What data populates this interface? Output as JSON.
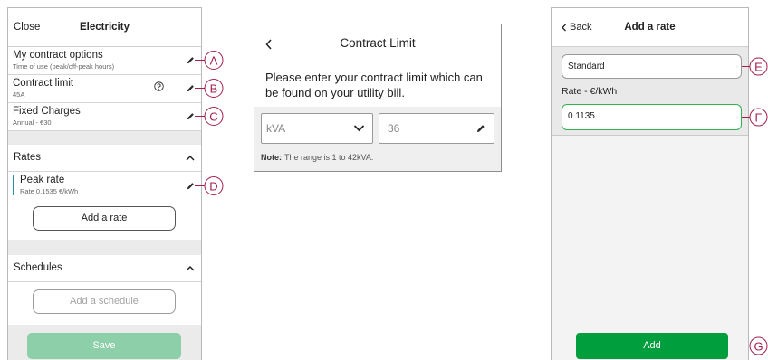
{
  "left": {
    "header": {
      "close": "Close",
      "title": "Electricity"
    },
    "rows": [
      {
        "title": "My contract options",
        "subtitle": "Time of use (peak/off-peak hours)"
      },
      {
        "title": "Contract limit",
        "subtitle": "45A"
      },
      {
        "title": "Fixed Charges",
        "subtitle": "Annual - €30"
      }
    ],
    "rates": {
      "title": "Rates",
      "items": [
        {
          "title": "Peak rate",
          "subtitle": "Rate 0.1535 €/kWh"
        }
      ],
      "add_label": "Add a rate"
    },
    "schedules": {
      "title": "Schedules",
      "add_label": "Add a schedule"
    },
    "save_label": "Save"
  },
  "contract_limit": {
    "title": "Contract Limit",
    "description_lines": [
      "Please enter your contract limit which can",
      "be found on your utility bill."
    ],
    "unit": "kVA",
    "value": "36",
    "note_label": "Note:",
    "note_text": "The range is 1 to 42kVA."
  },
  "add_rate": {
    "back": "Back",
    "title": "Add a rate",
    "name_value": "Standard",
    "rate_label": "Rate - €/kWh",
    "rate_value": "0.1135",
    "add_label": "Add"
  },
  "callout_labels": [
    "A",
    "B",
    "C",
    "D",
    "E",
    "F",
    "G"
  ],
  "icons": {
    "edit": "pencil-icon",
    "help": "question-circle-icon",
    "collapse": "chevron-up-icon",
    "dropdown": "chevron-down-icon",
    "back": "chevron-left-icon"
  },
  "colors": {
    "callout": "#a31f4b",
    "primary": "#009e3d",
    "primary_disabled": "#8dcfa8",
    "accent": "#2a8fa8",
    "focus": "#2fb34f"
  }
}
